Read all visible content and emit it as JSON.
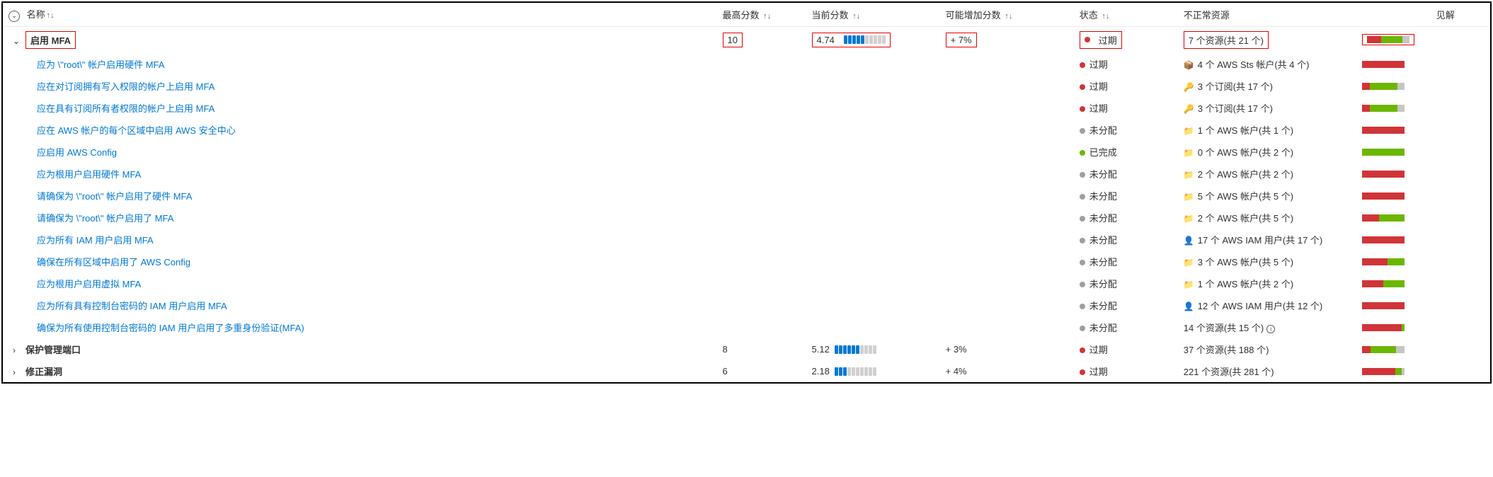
{
  "headers": {
    "name": "名称",
    "max_score": "最高分数",
    "current_score": "当前分数",
    "potential_increase": "可能增加分数",
    "status": "状态",
    "unhealthy": "不正常资源",
    "insights": "见解"
  },
  "status_labels": {
    "overdue": "过期",
    "unassigned": "未分配",
    "completed": "已完成"
  },
  "groups": [
    {
      "id": "mfa",
      "expanded": true,
      "highlighted": true,
      "name": "启用 MFA",
      "max_score": "10",
      "current_score": "4.74",
      "score_filled": 5,
      "score_total": 10,
      "potential_increase": "+ 7%",
      "status": "overdue",
      "unhealthy_text": "7 个资源(共 21 个)",
      "unhealthy_icon": "",
      "bar": {
        "red": 33,
        "green": 50,
        "grey": 17
      },
      "children": [
        {
          "name": "应为 \\\"root\\\" 帐户启用硬件 MFA",
          "status": "overdue",
          "unhealthy_icon": "📦",
          "unhealthy_text": "4 个 AWS Sts 帐户(共 4 个)",
          "bar": {
            "red": 100,
            "green": 0,
            "grey": 0
          }
        },
        {
          "name": "应在对订阅拥有写入权限的帐户上启用 MFA",
          "status": "overdue",
          "unhealthy_icon": "🔑",
          "unhealthy_text": "3 个订阅(共 17 个)",
          "bar": {
            "red": 18,
            "green": 65,
            "grey": 17
          }
        },
        {
          "name": "应在具有订阅所有者权限的帐户上启用 MFA",
          "status": "overdue",
          "unhealthy_icon": "🔑",
          "unhealthy_text": "3 个订阅(共 17 个)",
          "bar": {
            "red": 18,
            "green": 65,
            "grey": 17
          }
        },
        {
          "name": "应在 AWS 帐户的每个区域中启用 AWS 安全中心",
          "status": "unassigned",
          "unhealthy_icon": "📁",
          "unhealthy_text": "1 个 AWS 帐户(共 1 个)",
          "bar": {
            "red": 100,
            "green": 0,
            "grey": 0
          }
        },
        {
          "name": "应启用 AWS Config",
          "status": "completed",
          "unhealthy_icon": "📁",
          "unhealthy_text": "0 个 AWS 帐户(共 2 个)",
          "bar": {
            "red": 0,
            "green": 100,
            "grey": 0
          }
        },
        {
          "name": "应为根用户启用硬件 MFA",
          "status": "unassigned",
          "unhealthy_icon": "📁",
          "unhealthy_text": "2 个 AWS 帐户(共 2 个)",
          "bar": {
            "red": 100,
            "green": 0,
            "grey": 0
          }
        },
        {
          "name": "请确保为 \\\"root\\\" 帐户启用了硬件 MFA",
          "status": "unassigned",
          "unhealthy_icon": "📁",
          "unhealthy_text": "5 个 AWS 帐户(共 5 个)",
          "bar": {
            "red": 100,
            "green": 0,
            "grey": 0
          }
        },
        {
          "name": "请确保为 \\\"root\\\" 帐户启用了 MFA",
          "status": "unassigned",
          "unhealthy_icon": "📁",
          "unhealthy_text": "2 个 AWS 帐户(共 5 个)",
          "bar": {
            "red": 40,
            "green": 60,
            "grey": 0
          }
        },
        {
          "name": "应为所有 IAM 用户启用 MFA",
          "status": "unassigned",
          "unhealthy_icon": "👤",
          "unhealthy_text": "17 个 AWS IAM 用户(共 17 个)",
          "bar": {
            "red": 100,
            "green": 0,
            "grey": 0
          }
        },
        {
          "name": "确保在所有区域中启用了 AWS Config",
          "status": "unassigned",
          "unhealthy_icon": "📁",
          "unhealthy_text": "3 个 AWS 帐户(共 5 个)",
          "bar": {
            "red": 60,
            "green": 40,
            "grey": 0
          }
        },
        {
          "name": "应为根用户启用虚拟 MFA",
          "status": "unassigned",
          "unhealthy_icon": "📁",
          "unhealthy_text": "1 个 AWS 帐户(共 2 个)",
          "bar": {
            "red": 50,
            "green": 50,
            "grey": 0
          }
        },
        {
          "name": "应为所有具有控制台密码的 IAM 用户启用 MFA",
          "status": "unassigned",
          "unhealthy_icon": "👤",
          "unhealthy_text": "12 个 AWS IAM 用户(共 12 个)",
          "bar": {
            "red": 100,
            "green": 0,
            "grey": 0
          }
        },
        {
          "name": "确保为所有使用控制台密码的 IAM 用户启用了多重身份验证(MFA)",
          "status": "unassigned",
          "unhealthy_icon": "",
          "unhealthy_text": "14 个资源(共 15 个)",
          "has_info": true,
          "bar": {
            "red": 93,
            "green": 7,
            "grey": 0
          }
        }
      ]
    },
    {
      "id": "protect-ports",
      "expanded": false,
      "highlighted": false,
      "name": "保护管理端口",
      "max_score": "8",
      "current_score": "5.12",
      "score_filled": 6,
      "score_total": 10,
      "potential_increase": "+ 3%",
      "status": "overdue",
      "unhealthy_text": "37 个资源(共 188 个)",
      "unhealthy_icon": "",
      "bar": {
        "red": 20,
        "green": 60,
        "grey": 20
      },
      "children": []
    },
    {
      "id": "remediate-vuln",
      "expanded": false,
      "highlighted": false,
      "name": "修正漏洞",
      "max_score": "6",
      "current_score": "2.18",
      "score_filled": 3,
      "score_total": 10,
      "potential_increase": "+ 4%",
      "status": "overdue",
      "unhealthy_text": "221 个资源(共 281 个)",
      "unhealthy_icon": "",
      "bar": {
        "red": 79,
        "green": 14,
        "grey": 7
      },
      "children": []
    }
  ]
}
